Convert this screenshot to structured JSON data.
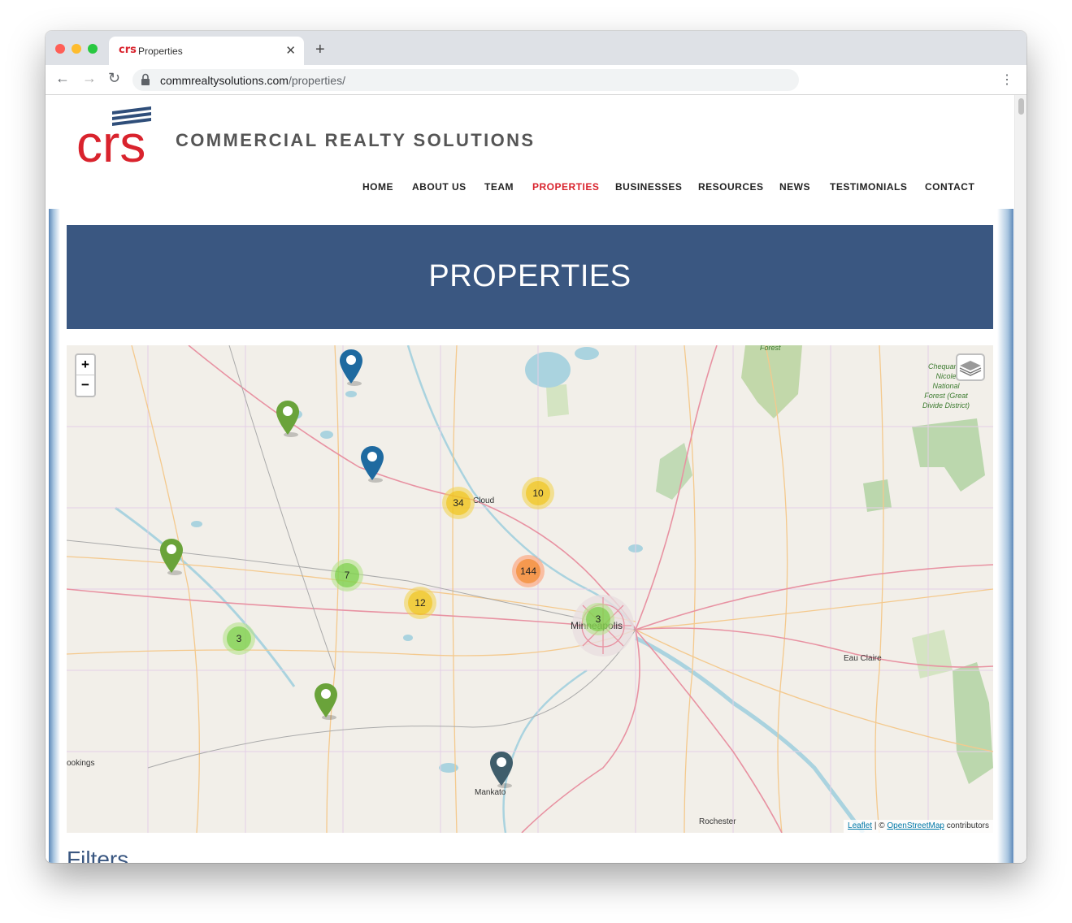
{
  "browser": {
    "tab_title": "Properties",
    "tab_favicon": "crs",
    "url_host": "commrealtysolutions.com",
    "url_path": "/properties/"
  },
  "site": {
    "logo_text": "crs",
    "brand_name": "COMMERCIAL REALTY SOLUTIONS",
    "nav": [
      "HOME",
      "ABOUT US",
      "TEAM",
      "PROPERTIES",
      "BUSINESSES",
      "RESOURCES",
      "NEWS",
      "TESTIMONIALS",
      "CONTACT"
    ],
    "active_nav": "PROPERTIES",
    "accent_color": "#d9232d",
    "hero_color": "#3a5781"
  },
  "page": {
    "title": "PROPERTIES",
    "filters_heading": "Filters"
  },
  "map": {
    "zoom_in": "+",
    "zoom_out": "−",
    "labels": {
      "st_cloud": "Cloud",
      "minneapolis": "Minneapolis",
      "eau_claire": "Eau Claire",
      "mankato": "Mankato",
      "rochester": "Rochester",
      "brookings": "ookings",
      "forest": "Forest",
      "chequamegon": "Chequame\nNicole\nNational\nForest (Great\nDivide District)"
    },
    "clusters": [
      {
        "count": "34",
        "color": "yellow"
      },
      {
        "count": "10",
        "color": "yellow"
      },
      {
        "count": "144",
        "color": "orange"
      },
      {
        "count": "7",
        "color": "green"
      },
      {
        "count": "12",
        "color": "yellow"
      },
      {
        "count": "3",
        "color": "green"
      },
      {
        "count": "3",
        "color": "green"
      }
    ],
    "attribution": {
      "leaflet": "Leaflet",
      "sep": " | © ",
      "osm": "OpenStreetMap",
      "contrib": " contributors"
    }
  },
  "icons": [
    "back-icon",
    "forward-icon",
    "reload-icon",
    "lock-icon",
    "menu-icon",
    "layers-icon",
    "map-pin-icon"
  ]
}
